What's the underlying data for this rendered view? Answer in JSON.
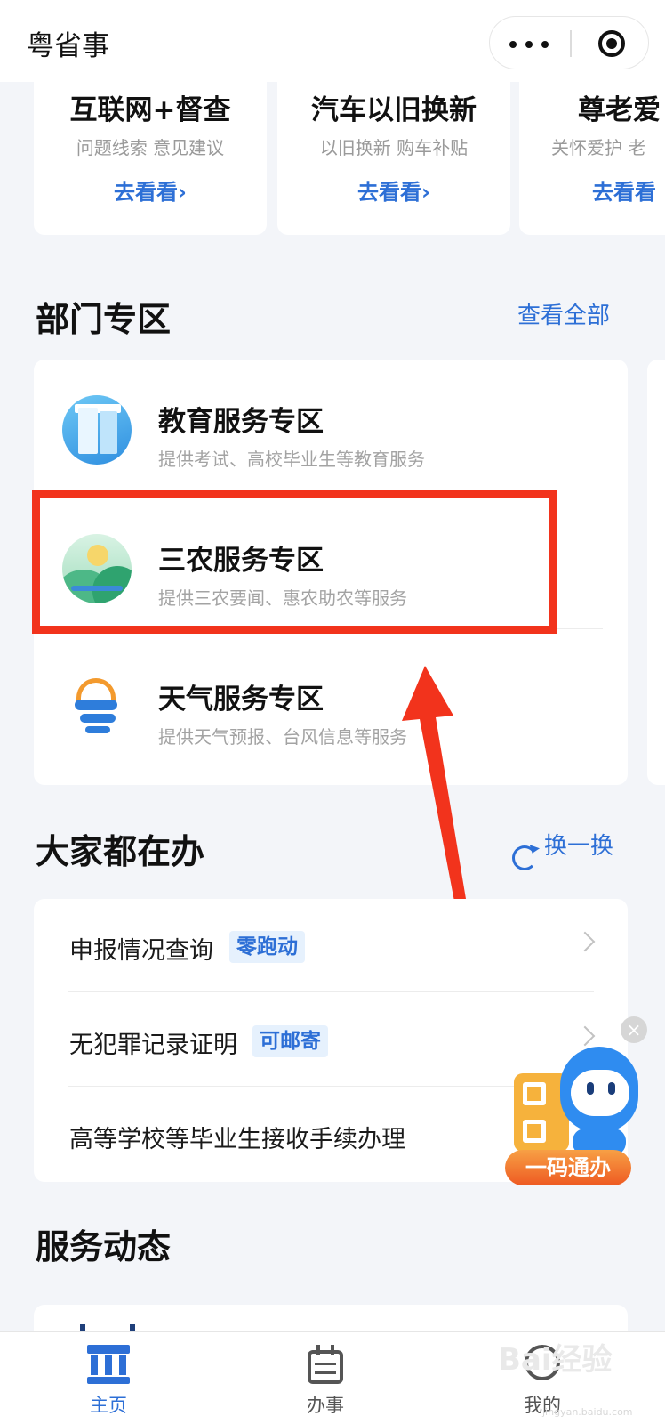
{
  "header": {
    "title": "粤省事",
    "more_icon": "more-dots-icon",
    "close_icon": "target-close-icon"
  },
  "top_cards": [
    {
      "title": "互联网+督查",
      "subtitle": "问题线索 意见建议",
      "action": "去看看›"
    },
    {
      "title": "汽车以旧换新",
      "subtitle": "以旧换新 购车补贴",
      "action": "去看看›"
    },
    {
      "title": "尊老爱",
      "subtitle": "关怀爱护 老",
      "action": "去看看"
    }
  ],
  "dept_section": {
    "title": "部门专区",
    "view_all": "查看全部",
    "items": [
      {
        "name": "教育服务专区",
        "desc": "提供考试、高校毕业生等教育服务",
        "icon": "education-icon"
      },
      {
        "name": "三农服务专区",
        "desc": "提供三农要闻、惠农助农等服务",
        "icon": "farm-icon"
      },
      {
        "name": "天气服务专区",
        "desc": "提供天气预报、台风信息等服务",
        "icon": "weather-icon"
      }
    ]
  },
  "todo_section": {
    "title": "大家都在办",
    "refresh": "换一换",
    "items": [
      {
        "label": "申报情况查询",
        "tag": "零跑动"
      },
      {
        "label": "无犯罪记录证明",
        "tag": "可邮寄"
      },
      {
        "label": "高等学校等毕业生接收手续办理",
        "tag": ""
      }
    ]
  },
  "floating": {
    "banner": "一码通办",
    "close": "×"
  },
  "news_section": {
    "title": "服务动态"
  },
  "tabbar": {
    "tabs": [
      {
        "label": "主页",
        "icon": "home-icon",
        "active": true
      },
      {
        "label": "办事",
        "icon": "calendar-icon",
        "active": false
      },
      {
        "label": "我的",
        "icon": "profile-icon",
        "active": false
      }
    ]
  },
  "watermark": {
    "text": "Bai经验",
    "sub": "jingyan.baidu.com"
  },
  "colors": {
    "accent": "#2d6fd6",
    "highlight": "#f2331c",
    "background": "#f3f5f9"
  }
}
